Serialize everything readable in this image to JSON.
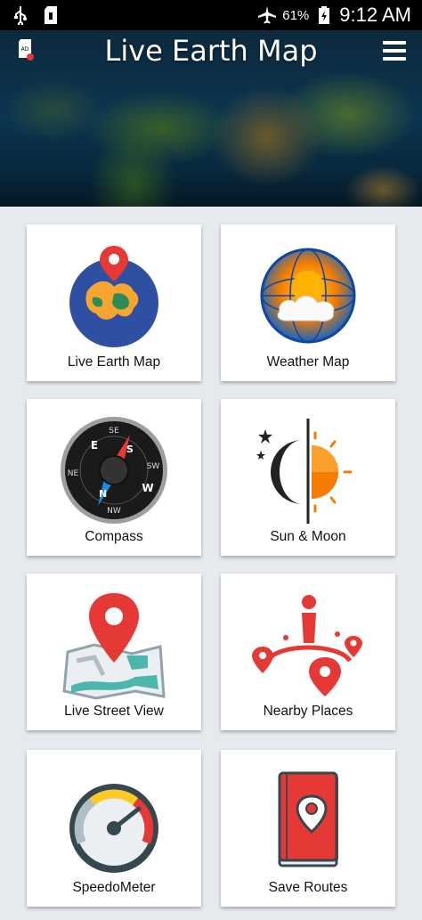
{
  "status_bar": {
    "battery_percent": "61%",
    "time": "9:12 AM"
  },
  "header": {
    "title": "Live Earth Map",
    "ad_icon_text": "AD"
  },
  "tiles": [
    {
      "label": "Live Earth Map",
      "icon": "globe-pin-icon"
    },
    {
      "label": "Weather Map",
      "icon": "weather-globe-icon"
    },
    {
      "label": "Compass",
      "icon": "compass-icon"
    },
    {
      "label": "Sun & Moon",
      "icon": "sun-moon-icon"
    },
    {
      "label": "Live Street View",
      "icon": "street-map-icon"
    },
    {
      "label": "Nearby Places",
      "icon": "nearby-places-icon"
    },
    {
      "label": "SpeedoMeter",
      "icon": "speedometer-icon"
    },
    {
      "label": "Save Routes",
      "icon": "save-routes-icon"
    }
  ],
  "colors": {
    "status_bar": "#000000",
    "background": "#e6eaef",
    "tile": "#ffffff",
    "accent_red": "#e53935"
  }
}
